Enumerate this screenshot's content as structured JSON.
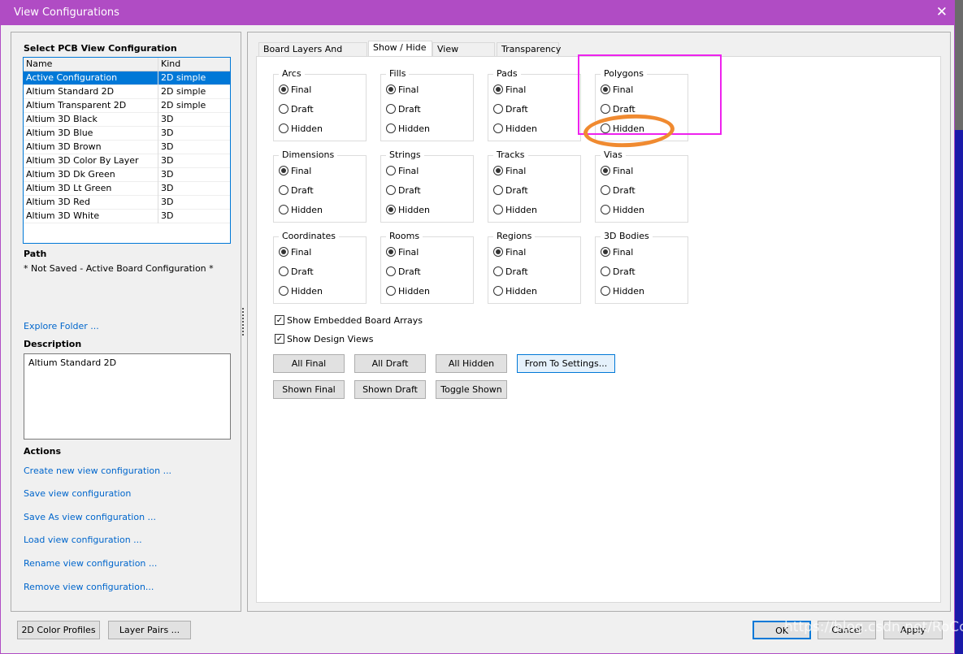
{
  "window": {
    "title": "View Configurations",
    "close": "✕"
  },
  "left": {
    "select_heading": "Select PCB View Configuration",
    "columns": [
      "Name",
      "Kind"
    ],
    "rows": [
      {
        "name": "Active Configuration",
        "kind": "2D simple",
        "selected": true
      },
      {
        "name": "Altium Standard 2D",
        "kind": "2D simple"
      },
      {
        "name": "Altium Transparent 2D",
        "kind": "2D simple"
      },
      {
        "name": "Altium 3D Black",
        "kind": "3D"
      },
      {
        "name": "Altium 3D Blue",
        "kind": "3D"
      },
      {
        "name": "Altium 3D Brown",
        "kind": "3D"
      },
      {
        "name": "Altium 3D Color By Layer",
        "kind": "3D"
      },
      {
        "name": "Altium 3D Dk Green",
        "kind": "3D"
      },
      {
        "name": "Altium 3D Lt Green",
        "kind": "3D"
      },
      {
        "name": "Altium 3D Red",
        "kind": "3D"
      },
      {
        "name": "Altium 3D White",
        "kind": "3D"
      }
    ],
    "path_heading": "Path",
    "path": "* Not Saved - Active Board Configuration *",
    "explore": "Explore Folder ...",
    "desc_heading": "Description",
    "description": "Altium Standard 2D",
    "actions_heading": "Actions",
    "actions": [
      "Create new view configuration ...",
      "Save view configuration",
      "Save As view configuration ...",
      "Load view configuration ...",
      "Rename view configuration ...",
      "Remove view configuration..."
    ]
  },
  "tabs": [
    {
      "label": "Board Layers And Colors"
    },
    {
      "label": "Show / Hide",
      "active": true
    },
    {
      "label": "View Options"
    },
    {
      "label": "Transparency"
    }
  ],
  "options": [
    "Final",
    "Draft",
    "Hidden"
  ],
  "groups": [
    {
      "label": "Arcs",
      "value": "Final"
    },
    {
      "label": "Fills",
      "value": "Final"
    },
    {
      "label": "Pads",
      "value": "Final"
    },
    {
      "label": "Polygons",
      "value": "Final"
    },
    {
      "label": "Dimensions",
      "value": "Final"
    },
    {
      "label": "Strings",
      "value": "Hidden"
    },
    {
      "label": "Tracks",
      "value": "Final"
    },
    {
      "label": "Vias",
      "value": "Final"
    },
    {
      "label": "Coordinates",
      "value": "Final"
    },
    {
      "label": "Rooms",
      "value": "Final"
    },
    {
      "label": "Regions",
      "value": "Final"
    },
    {
      "label": "3D Bodies",
      "value": "Final"
    }
  ],
  "checks": [
    {
      "label": "Show Embedded Board Arrays",
      "checked": true
    },
    {
      "label": "Show Design Views",
      "checked": true
    }
  ],
  "buttons": {
    "all_final": "All Final",
    "all_draft": "All Draft",
    "all_hidden": "All Hidden",
    "from_to": "From To Settings...",
    "shown_final": "Shown Final",
    "shown_draft": "Shown Draft",
    "toggle_shown": "Toggle Shown"
  },
  "footer": {
    "color_profiles": "2D Color Profiles",
    "layer_pairs": "Layer Pairs ...",
    "ok": "OK",
    "cancel": "Cancel",
    "apply": "Apply"
  },
  "watermark": "https://blog.csdn.net/RoCclay",
  "colors": {
    "title_bar": "#b04cc4",
    "selection": "#0078d7",
    "annotation_box": "#ee22ee",
    "annotation_circle": "#f08a30"
  }
}
